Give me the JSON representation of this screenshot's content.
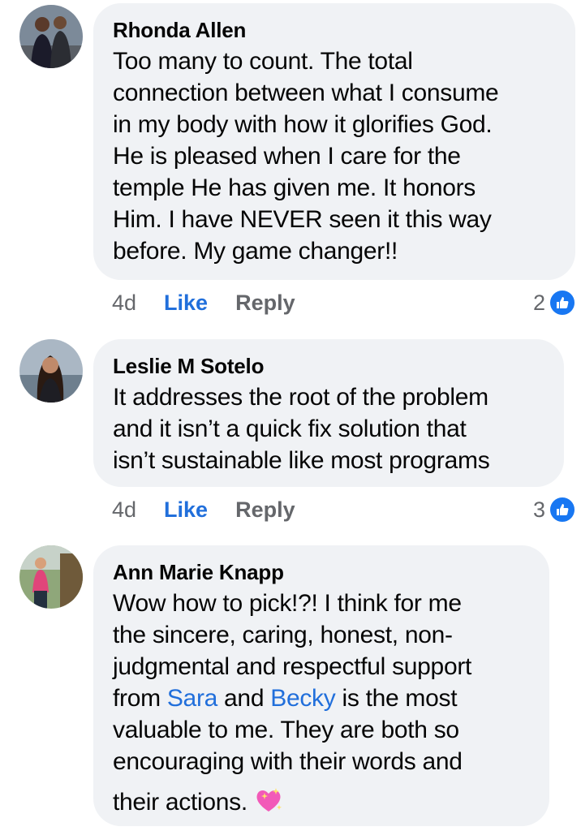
{
  "comments": [
    {
      "author": "Rhonda Allen",
      "lines": [
        "Too many to count. The total",
        "connection between what I consume",
        "in my body with how it glorifies God.",
        "He is pleased when I care for the",
        "temple He has given me. It honors",
        "Him. I have NEVER seen it this way",
        "before.  My game changer!!"
      ],
      "time": "4d",
      "like_label": "Like",
      "reply_label": "Reply",
      "reaction_count": "2",
      "reaction_icon": "like-thumb-icon"
    },
    {
      "author": "Leslie M Sotelo",
      "lines": [
        "It addresses the root of the problem",
        "and it isn’t a quick fix solution that",
        "isn’t sustainable like most programs"
      ],
      "time": "4d",
      "like_label": "Like",
      "reply_label": "Reply",
      "reaction_count": "3",
      "reaction_icon": "like-thumb-icon"
    },
    {
      "author": "Ann Marie Knapp",
      "lines": [
        "Wow how to pick!?!  I think for me",
        "the sincere, caring, honest, non-",
        "judgmental and respectful support",
        {
          "pre": "from ",
          "mention1": "Sara",
          "mid": " and ",
          "mention2": "Becky",
          "post": " is the most"
        },
        "valuable to me. They are both so",
        "encouraging with their words and",
        "their actions."
      ],
      "trailing_emoji": "sparkling-heart-icon"
    }
  ],
  "colors": {
    "bubble": "#f0f2f5",
    "link_blue": "#216fdb",
    "meta_gray": "#65676b",
    "reaction_blue": "#1877f2"
  }
}
